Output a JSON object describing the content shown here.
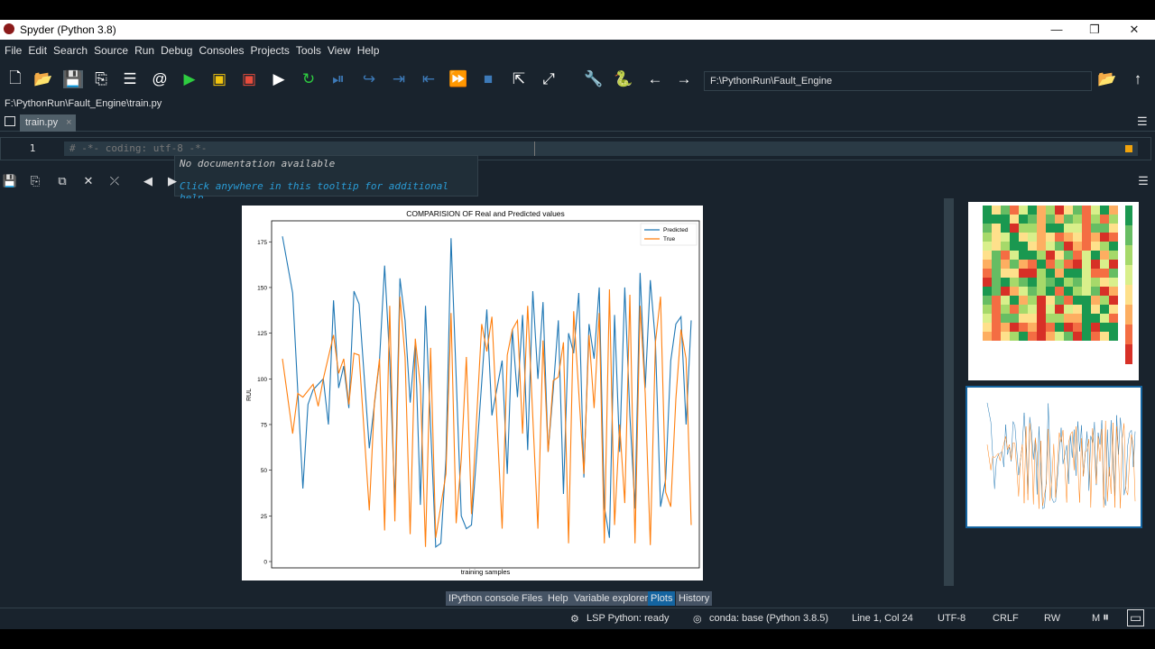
{
  "window": {
    "title": "Spyder (Python 3.8)",
    "minimize": "—",
    "restore": "❐",
    "close": "✕"
  },
  "menu": [
    "File",
    "Edit",
    "Search",
    "Source",
    "Run",
    "Debug",
    "Consoles",
    "Projects",
    "Tools",
    "View",
    "Help"
  ],
  "toolbar": {
    "path": "F:\\PythonRun\\Fault_Engine"
  },
  "editor": {
    "file_path": "F:\\PythonRun\\Fault_Engine\\train.py",
    "tab_label": "train.py",
    "tab_close": "×",
    "line_number": "1",
    "code": "# -*- coding: utf-8 -*-"
  },
  "tooltip": {
    "line1": "No documentation available",
    "line2": "Click anywhere in this tooltip for additional help"
  },
  "chart_data": {
    "type": "line",
    "title": "COMPARISION OF Real and Predicted values",
    "xlabel": "training samples",
    "ylabel": "RUL",
    "ylim": [
      0,
      185
    ],
    "yticks": [
      "0",
      "25",
      "50",
      "75",
      "100",
      "125",
      "150",
      "175"
    ],
    "legend_position": "top-right",
    "colors": {
      "Predicted": "#1f77b4",
      "True": "#ff7f0e"
    },
    "series": [
      {
        "name": "Predicted",
        "values": [
          178,
          147,
          40,
          86,
          94,
          100,
          75,
          143,
          95,
          107,
          84,
          148,
          141,
          62,
          86,
          110,
          162,
          110,
          32,
          155,
          132,
          87,
          120,
          31,
          140,
          8,
          10,
          56,
          177,
          25,
          18,
          20,
          58,
          138,
          80,
          110,
          48,
          127,
          90,
          135,
          61,
          148,
          100,
          142,
          60,
          94,
          132,
          37,
          125,
          114,
          147,
          46,
          130,
          111,
          150,
          30,
          13,
          135,
          60,
          150,
          80,
          29,
          158,
          95,
          154,
          120,
          30,
          45,
          110,
          130,
          134,
          75,
          132
        ],
        "x": [
          0,
          2,
          4,
          5,
          6,
          8,
          9,
          10,
          11,
          12,
          13,
          14,
          15,
          17,
          18,
          19,
          20,
          21,
          22,
          23,
          24,
          25,
          26,
          27,
          28,
          30,
          31,
          32,
          33,
          35,
          36,
          37,
          38,
          40,
          41,
          43,
          44,
          45,
          46,
          47,
          48,
          49,
          50,
          51,
          52,
          53,
          54,
          55,
          56,
          57,
          58,
          59,
          60,
          61,
          62,
          63,
          64,
          65,
          66,
          67,
          68,
          69,
          70,
          71,
          72,
          73,
          74,
          75,
          76,
          77,
          78,
          79,
          80
        ]
      },
      {
        "name": "True",
        "values": [
          111,
          70,
          92,
          90,
          97,
          85,
          100,
          124,
          103,
          111,
          86,
          114,
          113,
          28,
          87,
          111,
          17,
          140,
          22,
          145,
          112,
          15,
          122,
          96,
          8,
          117,
          13,
          48,
          136,
          21,
          56,
          112,
          26,
          130,
          115,
          134,
          18,
          113,
          127,
          132,
          70,
          140,
          18,
          121,
          60,
          99,
          101,
          120,
          10,
          137,
          48,
          124,
          84,
          136,
          10,
          149,
          20,
          75,
          32,
          146,
          10,
          140,
          92,
          9,
          120,
          145,
          38,
          30,
          89,
          127,
          111,
          20
        ],
        "x": [
          0,
          2,
          3,
          4,
          6,
          7,
          8,
          10,
          11,
          12,
          13,
          14,
          15,
          17,
          18,
          19,
          20,
          21,
          22,
          23,
          24,
          25,
          26,
          27,
          28,
          29,
          30,
          32,
          33,
          34,
          35,
          36,
          37,
          39,
          40,
          41,
          43,
          44,
          45,
          46,
          47,
          48,
          50,
          51,
          52,
          53,
          54,
          55,
          56,
          57,
          59,
          60,
          61,
          62,
          63,
          64,
          65,
          66,
          67,
          68,
          69,
          70,
          71,
          72,
          73,
          74,
          75,
          76,
          77,
          78,
          79,
          80
        ]
      }
    ]
  },
  "bottom_tabs": [
    "IPython console",
    "Files",
    "Help",
    "Variable explorer",
    "Plots",
    "History"
  ],
  "active_tab": "Plots",
  "status": {
    "lsp": "LSP Python: ready",
    "conda": "conda: base (Python 3.8.5)",
    "position": "Line 1, Col 24",
    "encoding": "UTF-8",
    "eol": "CRLF",
    "permissions": "RW",
    "mem": "M"
  }
}
